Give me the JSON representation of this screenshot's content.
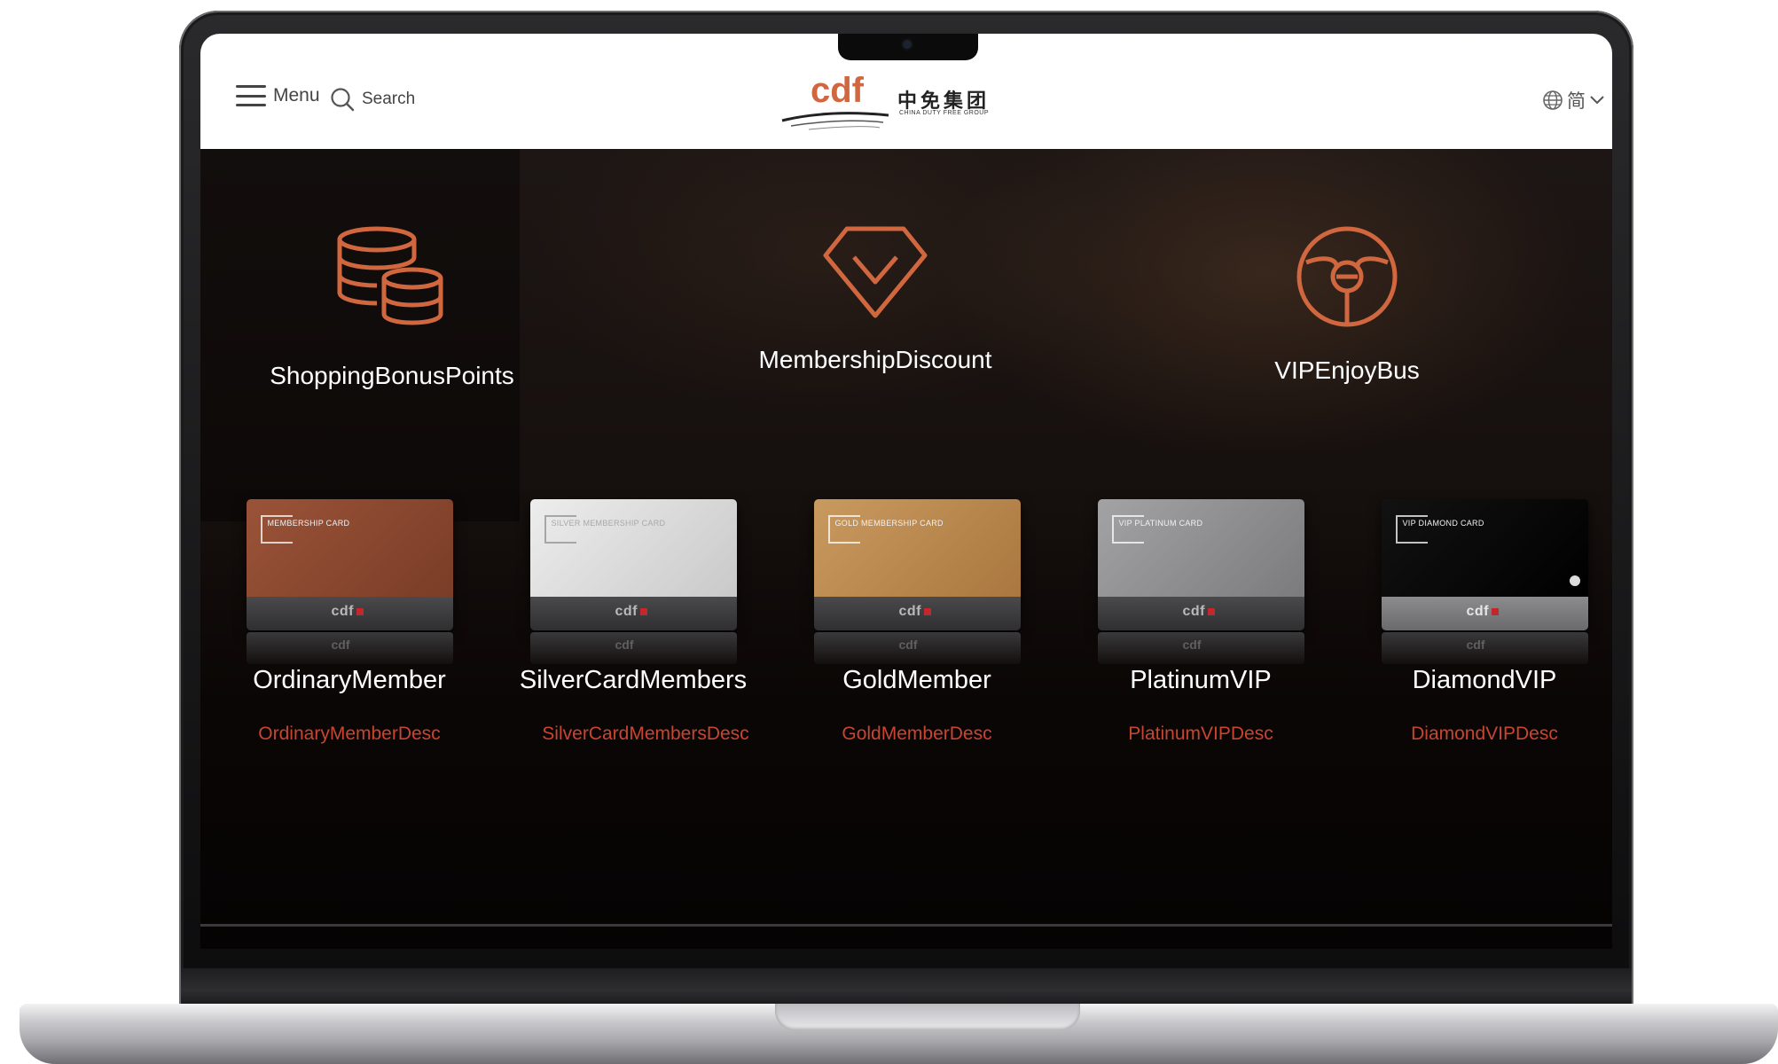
{
  "header": {
    "menu_label": "Menu",
    "search_label": "Search",
    "logo_text": "cdf",
    "logo_cn": "中免集团",
    "logo_en": "CHINA DUTY FREE GROUP",
    "language_label": "简",
    "icons": {
      "menu": "hamburger-icon",
      "search": "search-icon",
      "language": "globe-icon",
      "dropdown": "chevron-down-icon"
    }
  },
  "benefits": [
    {
      "label": "ShoppingBonusPoints",
      "icon": "coins-stack-icon"
    },
    {
      "label": "MembershipDiscount",
      "icon": "diamond-check-icon"
    },
    {
      "label": "VIPEnjoyBus",
      "icon": "steering-wheel-icon"
    }
  ],
  "tiers": [
    {
      "name": "OrdinaryMember",
      "desc": "OrdinaryMemberDesc",
      "card_title": "MEMBERSHIP CARD",
      "card_brand": "cdf",
      "card_color": "#8a4a32"
    },
    {
      "name": "SilverCardMembers",
      "desc": "SilverCardMembersDesc",
      "card_title": "SILVER MEMBERSHIP CARD",
      "card_brand": "cdf",
      "card_color": "#d9d9d9"
    },
    {
      "name": "GoldMember",
      "desc": "GoldMemberDesc",
      "card_title": "GOLD MEMBERSHIP CARD",
      "card_brand": "cdf",
      "card_color": "#b98a55"
    },
    {
      "name": "PlatinumVIP",
      "desc": "PlatinumVIPDesc",
      "card_title": "VIP PLATINUM CARD",
      "card_brand": "cdf",
      "card_color": "#8e8e90"
    },
    {
      "name": "DiamondVIP",
      "desc": "DiamondVIPDesc",
      "card_title": "VIP DIAMOND CARD",
      "card_brand": "cdf",
      "card_color": "#0a0a0a"
    }
  ],
  "colors": {
    "accent": "#d0673f",
    "desc_text": "#c8452f",
    "background": "#050303"
  }
}
